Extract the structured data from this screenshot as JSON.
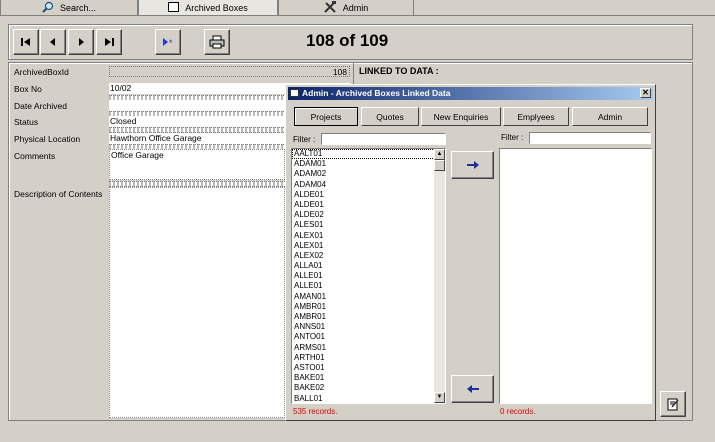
{
  "top_tabs": [
    {
      "label": "Search...",
      "icon": "magnifier-icon"
    },
    {
      "label": "Archived Boxes",
      "icon": "box-icon"
    },
    {
      "label": "Admin",
      "icon": "tools-icon"
    }
  ],
  "record_counter": "108 of 109",
  "form": {
    "archived_box_id_label": "ArchivedBoxId",
    "archived_box_id_value": "108",
    "box_no_label": "Box No",
    "box_no_value": "10/02",
    "date_archived_label": "Date Archived",
    "date_archived_value": "",
    "status_label": "Status",
    "status_value": "Closed",
    "physical_location_label": "Physical Location",
    "physical_location_value": "Hawthorn Office Garage",
    "comments_label": "Comments",
    "comments_value": "Office Garage",
    "description_label": "Description of Contents",
    "description_value": ""
  },
  "linked_label": "LINKED TO DATA :",
  "dialog": {
    "title": "Admin - Archived Boxes Linked Data",
    "tabs": [
      "Projects",
      "Quotes",
      "New Enquiries",
      "Emplyees",
      "Admin"
    ],
    "selected_tab": "Projects",
    "filter_label_left": "Filter :",
    "filter_label_right": "Filter :",
    "left_filter_value": "",
    "right_filter_value": "",
    "left_items": [
      "AALT01",
      "ADAM01",
      "ADAM02",
      "ADAM04",
      "ALDE01",
      "ALDE01",
      "ALDE02",
      "ALES01",
      "ALEX01",
      "ALEX01",
      "ALEX02",
      "ALLA01",
      "ALLE01",
      "ALLE01",
      "AMAN01",
      "AMBR01",
      "AMBR01",
      "ANNS01",
      "ANTO01",
      "ARMS01",
      "ARTH01",
      "ASTO01",
      "BAKE01",
      "BAKE02",
      "BALL01"
    ],
    "left_count": "535 records.",
    "right_count": "0 records."
  }
}
